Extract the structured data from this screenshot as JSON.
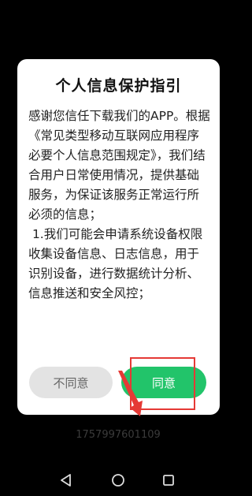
{
  "dialog": {
    "title": "个人信息保护指引",
    "body": "感谢您信任下载我们的APP。根据《常见类型移动互联网应用程序必要个人信息范围规定》，我们结合用户日常使用情况，提供基础服务，为保证该服务正常运行所必须的信息；\n 1.我们可能会申请系统设备权限收集设备信息、日志信息，用于识别设备，进行数据统计分析、信息推送和安全风控；",
    "disagree_label": "不同意",
    "agree_label": "同意"
  },
  "background": {
    "id_text": "1757997601109"
  },
  "annotation": {
    "highlight_color": "#e53935"
  },
  "navbar": {
    "back_icon": "back-triangle-icon",
    "home_icon": "home-circle-icon",
    "recents_icon": "recents-square-icon"
  },
  "colors": {
    "agree_button": "#22c46a",
    "disagree_button": "#e3e3e3"
  }
}
